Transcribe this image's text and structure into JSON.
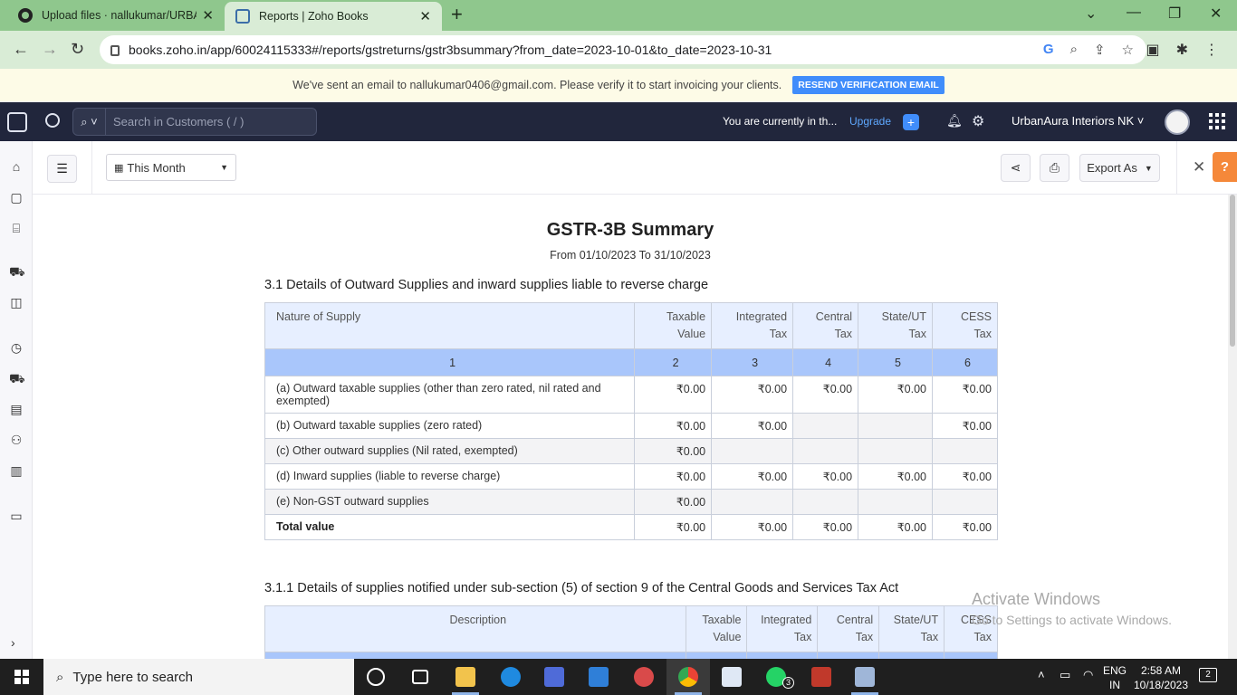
{
  "browser": {
    "tabs": [
      {
        "title": "Upload files · nallukumar/URBAN",
        "active": false
      },
      {
        "title": "Reports | Zoho Books",
        "active": true
      }
    ],
    "url": "books.zoho.in/app/60024115333#/reports/gstreturns/gstr3bsummary?from_date=2023-10-01&to_date=2023-10-31"
  },
  "banner": {
    "message": "We've sent an email to nallukumar0406@gmail.com. Please verify it to start invoicing your clients.",
    "resend_label": "RESEND VERIFICATION EMAIL"
  },
  "topnav": {
    "search_placeholder": "Search in Customers ( / )",
    "trial_text": "You are currently in th...",
    "upgrade_label": "Upgrade",
    "org_name": "UrbanAura Interiors NK ˅"
  },
  "toolbar": {
    "date_filter": "This Month",
    "export_label": "Export As"
  },
  "report": {
    "title": "GSTR-3B Summary",
    "range": "From 01/10/2023  To 31/10/2023",
    "section_31": {
      "title": "3.1 Details of Outward Supplies and inward supplies liable to reverse charge",
      "headers": [
        "Nature of Supply",
        "Taxable Value",
        "Integrated Tax",
        "Central Tax",
        "State/UT Tax",
        "CESS Tax"
      ],
      "header_lines": [
        [
          "Nature of Supply"
        ],
        [
          "Taxable",
          "Value"
        ],
        [
          "Integrated",
          "Tax"
        ],
        [
          "Central",
          "Tax"
        ],
        [
          "State/UT",
          "Tax"
        ],
        [
          "CESS",
          "Tax"
        ]
      ],
      "col_numbers": [
        "1",
        "2",
        "3",
        "4",
        "5",
        "6"
      ],
      "rows": [
        {
          "label": "(a) Outward taxable supplies (other than zero rated, nil rated and exempted)",
          "values": [
            "₹0.00",
            "₹0.00",
            "₹0.00",
            "₹0.00",
            "₹0.00"
          ]
        },
        {
          "label": "(b) Outward taxable supplies (zero rated)",
          "values": [
            "₹0.00",
            "₹0.00",
            "",
            "",
            "₹0.00"
          ]
        },
        {
          "label": "(c) Other outward supplies (Nil rated, exempted)",
          "values": [
            "₹0.00",
            "",
            "",
            "",
            ""
          ]
        },
        {
          "label": "(d) Inward supplies (liable to reverse charge)",
          "values": [
            "₹0.00",
            "₹0.00",
            "₹0.00",
            "₹0.00",
            "₹0.00"
          ]
        },
        {
          "label": "(e) Non-GST outward supplies",
          "values": [
            "₹0.00",
            "",
            "",
            "",
            ""
          ]
        },
        {
          "label": "Total value",
          "values": [
            "₹0.00",
            "₹0.00",
            "₹0.00",
            "₹0.00",
            "₹0.00"
          ]
        }
      ]
    },
    "section_311": {
      "title": "3.1.1 Details of supplies notified under sub-section (5) of section 9 of the Central Goods and Services Tax Act",
      "header_lines": [
        [
          "Description"
        ],
        [
          "Taxable",
          "Value"
        ],
        [
          "Integrated",
          "Tax"
        ],
        [
          "Central",
          "Tax"
        ],
        [
          "State/UT",
          "Tax"
        ],
        [
          "CESS",
          "Tax"
        ]
      ]
    }
  },
  "watermark": {
    "line1": "Activate Windows",
    "line2": "Go to Settings to activate Windows."
  },
  "taskbar": {
    "search_placeholder": "Type here to search",
    "lang_line1": "ENG",
    "lang_line2": "IN",
    "time": "2:58 AM",
    "date": "10/18/2023",
    "notification_count": "2",
    "whatsapp_badge": "3"
  },
  "colors": {
    "tab_strip": "#8fc78d",
    "topnav": "#21263c",
    "accent": "#408dfb",
    "header_row": "#e7efff",
    "colnum_row": "#a9c6fb",
    "help": "#f5883a"
  }
}
